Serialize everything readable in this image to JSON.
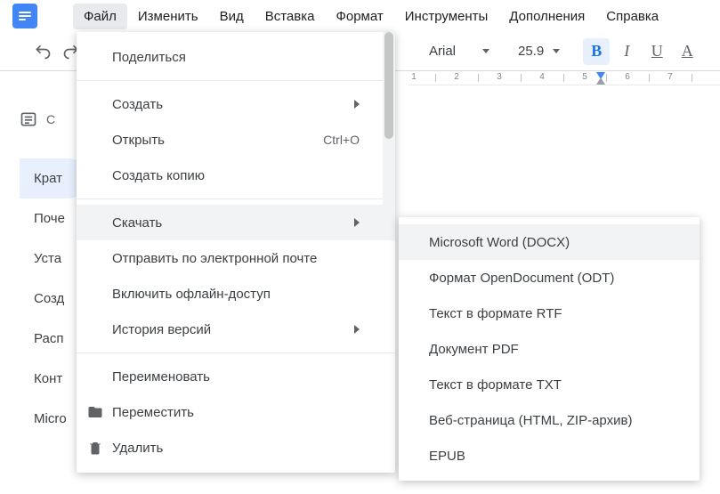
{
  "menubar": {
    "items": [
      "Файл",
      "Изменить",
      "Вид",
      "Вставка",
      "Формат",
      "Инструменты",
      "Дополнения",
      "Справка"
    ],
    "active_index": 0
  },
  "toolbar": {
    "font_name": "Arial",
    "font_size": "25.9"
  },
  "outline": {
    "title_fragment": "С",
    "items": [
      "Крат",
      "Поче",
      "Уста",
      "Созд",
      "Расп",
      "Конт",
      "Micro"
    ],
    "selected_index": 0
  },
  "file_menu": {
    "share": "Поделиться",
    "create": "Создать",
    "open": "Открыть",
    "open_shortcut": "Ctrl+O",
    "make_copy": "Создать копию",
    "download": "Скачать",
    "email": "Отправить по электронной почте",
    "offline": "Включить офлайн-доступ",
    "version_history": "История версий",
    "rename": "Переименовать",
    "move": "Переместить",
    "delete": "Удалить"
  },
  "download_submenu": {
    "items": [
      "Microsoft Word (DOCX)",
      "Формат OpenDocument (ODT)",
      "Текст в формате RTF",
      "Документ PDF",
      "Текст в формате TXT",
      "Веб-страница (HTML, ZIP-архив)",
      "EPUB"
    ],
    "highlighted_index": 0
  },
  "ruler": {
    "numbers": [
      "1",
      "2",
      "3",
      "4",
      "5",
      "6",
      "7"
    ]
  }
}
